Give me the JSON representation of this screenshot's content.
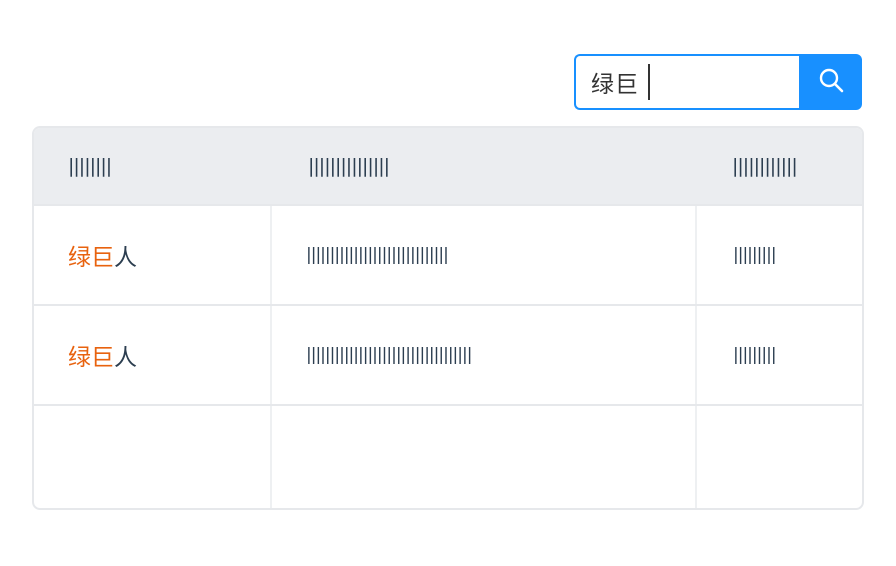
{
  "search": {
    "value": "绿巨",
    "icon": "search-icon",
    "accent": "#1890ff"
  },
  "table": {
    "columns": [
      "||||||||",
      "|||||||||||||||",
      "||||||||||||"
    ],
    "rows": [
      {
        "name_highlight": "绿巨",
        "name_rest": "人",
        "col2": "||||||||||||||||||||||||||||||",
        "col3": "|||||||||"
      },
      {
        "name_highlight": "绿巨",
        "name_rest": "人",
        "col2": "|||||||||||||||||||||||||||||||||||",
        "col3": "|||||||||"
      },
      {
        "name_highlight": "",
        "name_rest": "",
        "col2": "",
        "col3": ""
      }
    ],
    "highlight_color": "#e8620e"
  }
}
